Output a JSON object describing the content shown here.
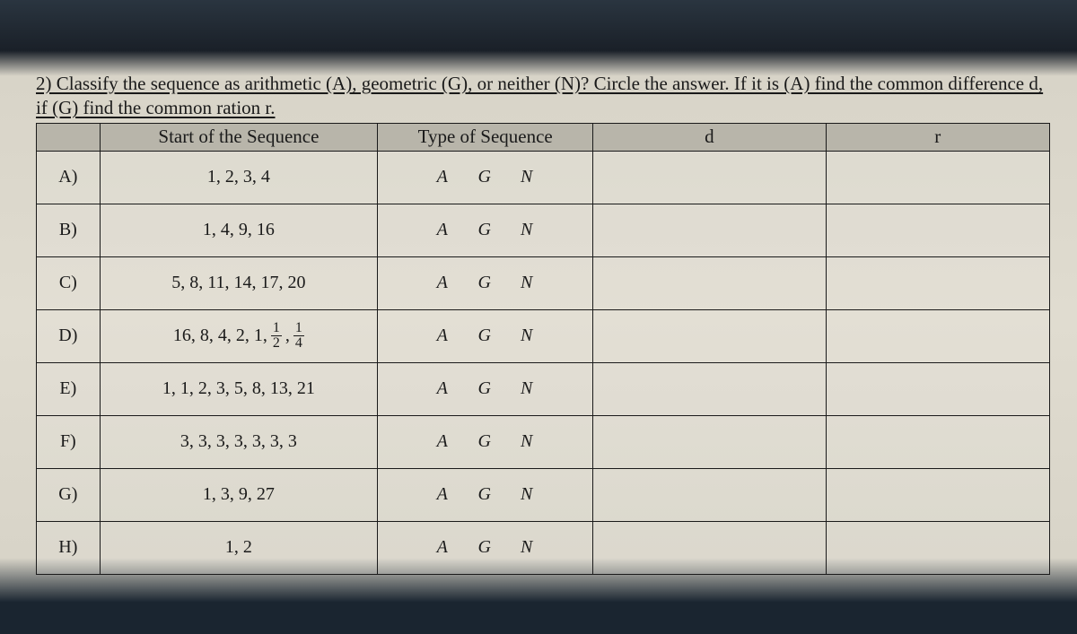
{
  "question": "2) Classify the sequence as arithmetic (A), geometric (G), or neither (N)?  Circle the answer. If it is (A) find the common difference d, if (G) find the common ration r.",
  "headers": {
    "blank": "",
    "seq": "Start of the Sequence",
    "type": "Type of Sequence",
    "d": "d",
    "r": "r"
  },
  "type_options": {
    "a": "A",
    "g": "G",
    "n": "N"
  },
  "rows": [
    {
      "label": "A)",
      "sequence": "1, 2, 3, 4",
      "hasFractions": false
    },
    {
      "label": "B)",
      "sequence": "1, 4, 9, 16",
      "hasFractions": false
    },
    {
      "label": "C)",
      "sequence": "5, 8, 11, 14, 17, 20",
      "hasFractions": false
    },
    {
      "label": "D)",
      "sequence_prefix": "16, 8, 4, 2, 1, ",
      "frac1_num": "1",
      "frac1_den": "2",
      "sep": ", ",
      "frac2_num": "1",
      "frac2_den": "4",
      "hasFractions": true
    },
    {
      "label": "E)",
      "sequence": "1, 1, 2, 3, 5, 8, 13, 21",
      "hasFractions": false
    },
    {
      "label": "F)",
      "sequence": "3, 3, 3, 3, 3, 3, 3",
      "hasFractions": false
    },
    {
      "label": "G)",
      "sequence": "1, 3, 9, 27",
      "hasFractions": false
    },
    {
      "label": "H)",
      "sequence": "1, 2",
      "hasFractions": false
    }
  ]
}
